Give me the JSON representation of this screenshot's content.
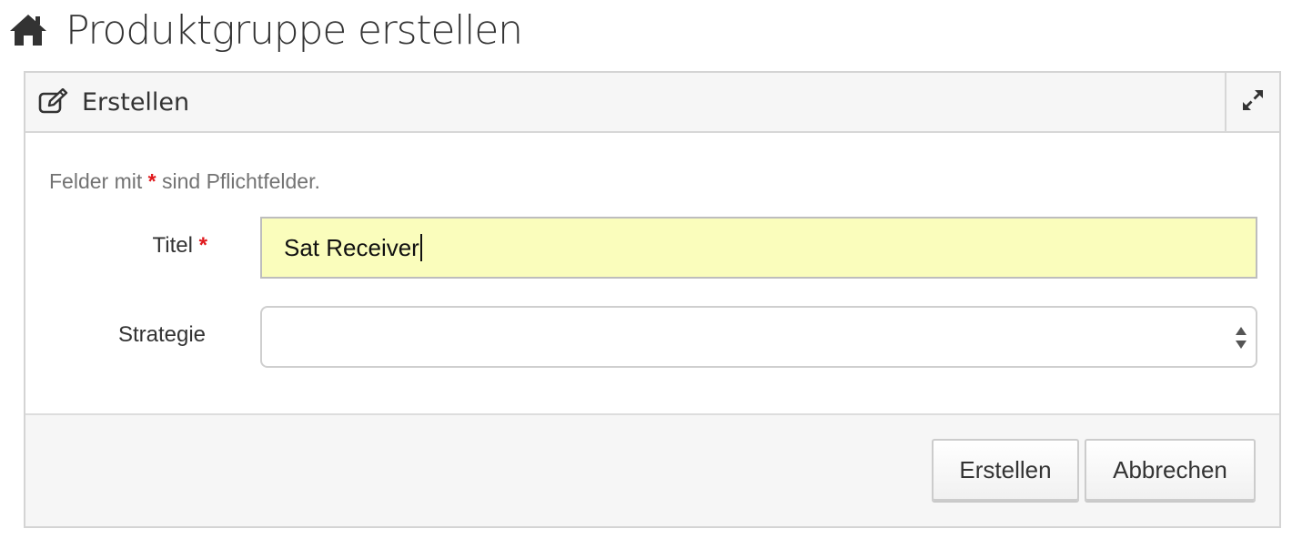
{
  "header": {
    "icon": "home-icon",
    "title": "Produktgruppe erstellen"
  },
  "panel": {
    "icon": "edit-icon",
    "title": "Erstellen",
    "expand_icon": "expand-icon"
  },
  "form": {
    "required_note_prefix": "Felder mit",
    "required_star": "*",
    "required_note_suffix": "sind Pflichtfelder.",
    "titel": {
      "label": "Titel",
      "required_star": "*",
      "value": "Sat Receiver"
    },
    "strategie": {
      "label": "Strategie",
      "value": ""
    }
  },
  "footer": {
    "create_label": "Erstellen",
    "cancel_label": "Abbrechen"
  },
  "colors": {
    "required": "#e0191d",
    "input_highlight": "#fafdbc",
    "panel_bg": "#f6f6f6"
  }
}
